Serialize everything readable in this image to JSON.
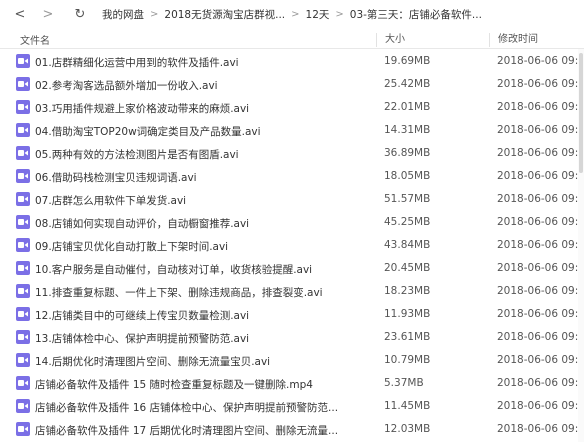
{
  "toolbar": {
    "back_glyph": "<",
    "forward_glyph": ">",
    "refresh_glyph": "↻",
    "separator": ">",
    "breadcrumbs": [
      "我的网盘",
      "2018无货源淘宝店群视...",
      "12天",
      "03-第三天：店铺必备软件..."
    ]
  },
  "columns": {
    "name": "文件名",
    "size": "大小",
    "time": "修改时间"
  },
  "files": [
    {
      "name": "01.店群精细化运营中用到的软件及插件.avi",
      "size": "19.69MB",
      "time": "2018-06-06 09:1"
    },
    {
      "name": "02.参考淘客选品额外增加一份收入.avi",
      "size": "25.42MB",
      "time": "2018-06-06 09:1"
    },
    {
      "name": "03.巧用插件规避上家价格波动带来的麻烦.avi",
      "size": "22.01MB",
      "time": "2018-06-06 09:1"
    },
    {
      "name": "04.借助淘宝TOP20w词确定类目及产品数量.avi",
      "size": "14.31MB",
      "time": "2018-06-06 09:1"
    },
    {
      "name": "05.两种有效的方法检测图片是否有图盾.avi",
      "size": "36.89MB",
      "time": "2018-06-06 09:1"
    },
    {
      "name": "06.借助码栈检测宝贝违规词语.avi",
      "size": "18.05MB",
      "time": "2018-06-06 09:1"
    },
    {
      "name": "07.店群怎么用软件下单发货.avi",
      "size": "51.57MB",
      "time": "2018-06-06 09:1"
    },
    {
      "name": "08.店铺如何实现自动评价，自动橱窗推荐.avi",
      "size": "45.25MB",
      "time": "2018-06-06 09:1"
    },
    {
      "name": "09.店铺宝贝优化自动打散上下架时间.avi",
      "size": "43.84MB",
      "time": "2018-06-06 09:1"
    },
    {
      "name": "10.客户服务是自动催付，自动核对订单，收货核验提醒.avi",
      "size": "20.45MB",
      "time": "2018-06-06 09:1"
    },
    {
      "name": "11.排查重复标题、一件上下架、删除违规商品，排查裂变.avi",
      "size": "18.23MB",
      "time": "2018-06-06 09:1"
    },
    {
      "name": "12.店铺类目中的可继续上传宝贝数量检测.avi",
      "size": "11.93MB",
      "time": "2018-06-06 09:1"
    },
    {
      "name": "13.店铺体检中心、保护声明提前预警防范.avi",
      "size": "23.61MB",
      "time": "2018-06-06 09:1"
    },
    {
      "name": "14.后期优化时清理图片空间、删除无流量宝贝.avi",
      "size": "10.79MB",
      "time": "2018-06-06 09:1"
    },
    {
      "name": "店铺必备软件及插件 15 随时检查重复标题及一键删除.mp4",
      "size": "5.37MB",
      "time": "2018-06-06 09:1"
    },
    {
      "name": "店铺必备软件及插件 16 店铺体检中心、保护声明提前预警防范...",
      "size": "11.45MB",
      "time": "2018-06-06 09:1"
    },
    {
      "name": "店铺必备软件及插件 17 后期优化时清理图片空间、删除无流量...",
      "size": "12.03MB",
      "time": "2018-06-06 09:1"
    }
  ],
  "colors": {
    "video_icon": "#7b6fe6"
  }
}
